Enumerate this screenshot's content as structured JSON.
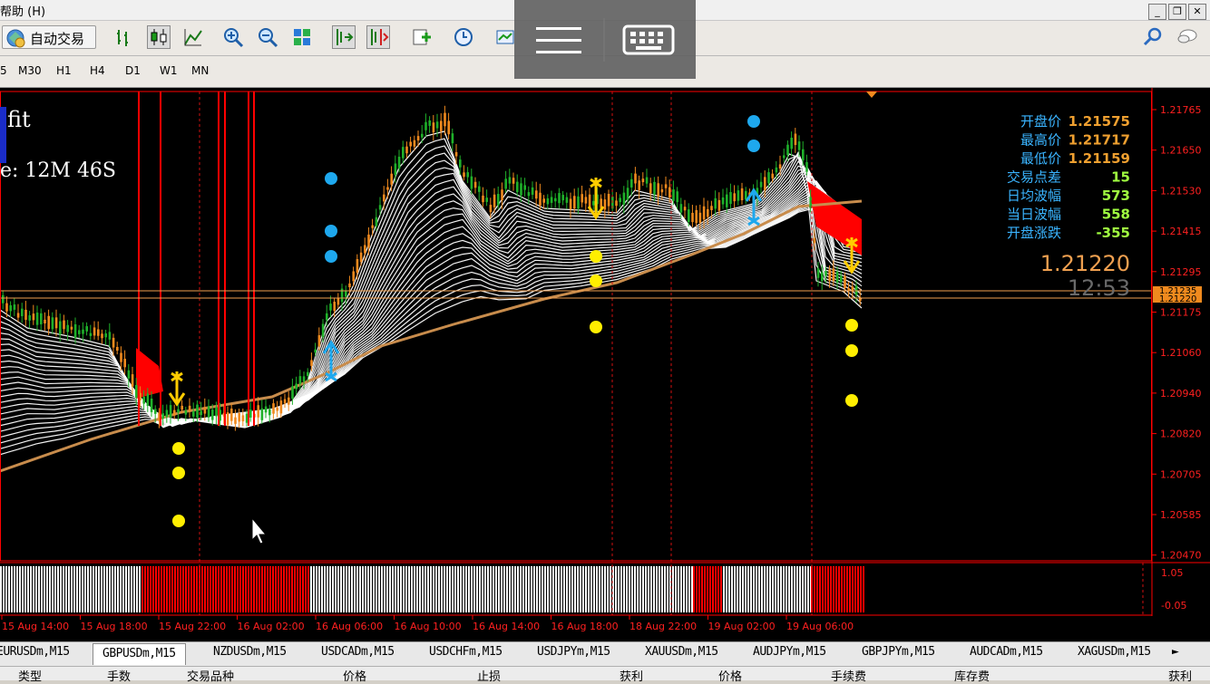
{
  "menu": {
    "help_label": "帮助 (H)"
  },
  "toolbar": {
    "auto_trade_label": "自动交易"
  },
  "timeframes": [
    "5",
    "M30",
    "H1",
    "H4",
    "D1",
    "W1",
    "MN"
  ],
  "chart": {
    "label_fit": "fit",
    "label_time": "e: 12M 46S",
    "info_labels": [
      "开盘价",
      "最高价",
      "最低价",
      "交易点差",
      "日均波幅",
      "当日波幅",
      "开盘涨跌"
    ],
    "info_values": [
      "1.21575",
      "1.21717",
      "1.21159",
      "15",
      "573",
      "558",
      "-355"
    ],
    "big_price": "1.21220",
    "countdown": "12:53",
    "price_ticks": [
      "1.21765",
      "1.21650",
      "1.21530",
      "1.21415",
      "1.21295",
      "1.21175",
      "1.21060",
      "1.20940",
      "1.20820",
      "1.20705",
      "1.20585",
      "1.20470"
    ],
    "price_tag_upper": "1.21235",
    "price_tag_lower": "1.21220",
    "indicator_ticks": [
      "1.05",
      "-0.05"
    ],
    "time_ticks": [
      "15 Aug 14:00",
      "15 Aug 18:00",
      "15 Aug 22:00",
      "16 Aug 02:00",
      "16 Aug 06:00",
      "16 Aug 10:00",
      "16 Aug 14:00",
      "16 Aug 18:00",
      "18 Aug 22:00",
      "19 Aug 02:00",
      "19 Aug 06:00"
    ],
    "colors": {
      "bull": "#1fb12a",
      "bear": "#f08a1e",
      "ma": "#c88c4c",
      "ribbon": "#ffffff",
      "cloud": "#ff0000",
      "dot_blue": "#1ea8ee",
      "dot_yellow": "#ffee00",
      "axis": "#ff0000"
    }
  },
  "symbol_tabs": [
    "EURUSDm,M15",
    "GBPUSDm,M15",
    "NZDUSDm,M15",
    "USDCADm,M15",
    "USDCHFm,M15",
    "USDJPYm,M15",
    "XAUUSDm,M15",
    "AUDJPYm,M15",
    "GBPJPYm,M15",
    "AUDCADm,M15",
    "XAGUSDm,M15"
  ],
  "active_tab": "GBPUSDm,M15",
  "column_headers": [
    "类型",
    "手数",
    "交易品种",
    "价格",
    "止损",
    "获利",
    "价格",
    "手续费",
    "库存费",
    "获利"
  ]
}
